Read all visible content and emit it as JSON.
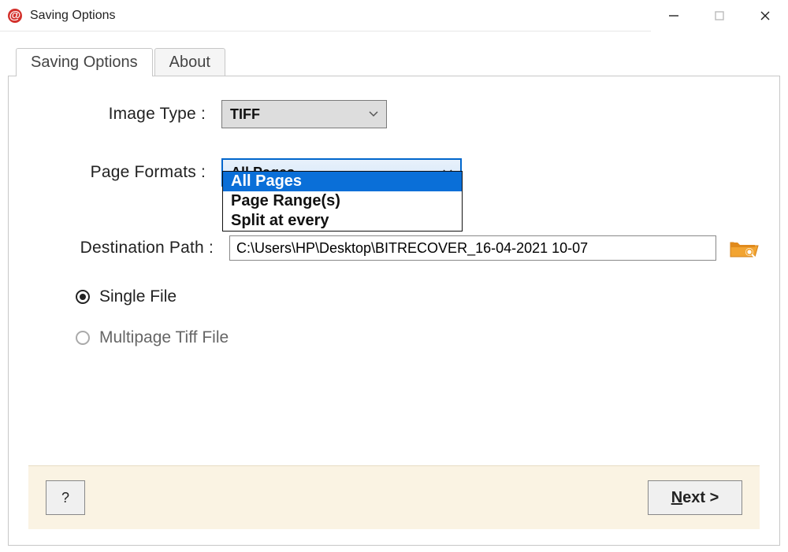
{
  "window": {
    "title": "Saving Options",
    "app_icon_glyph": "@"
  },
  "tabs": {
    "saving": "Saving Options",
    "about": "About"
  },
  "labels": {
    "image_type": "Image Type  :",
    "page_formats": "Page Formats  :",
    "destination": "Destination Path :"
  },
  "image_type": {
    "value": "TIFF"
  },
  "page_formats": {
    "value": "All Pages",
    "options": [
      "All Pages",
      "Page Range(s)",
      "Split at every"
    ]
  },
  "destination_path": "C:\\Users\\HP\\Desktop\\BITRECOVER_16-04-2021 10-07",
  "radios": {
    "single": "Single File",
    "multipage": "Multipage Tiff File"
  },
  "buttons": {
    "help": "?",
    "next_underline": "N",
    "next_rest": "ext >"
  }
}
